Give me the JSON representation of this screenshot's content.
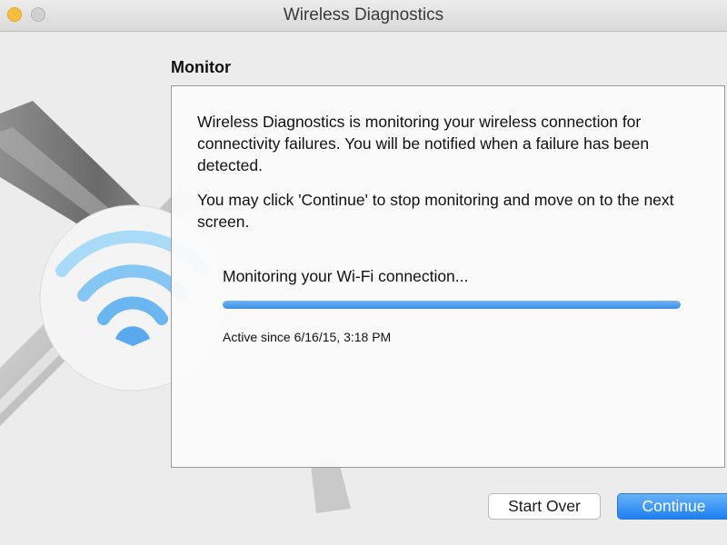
{
  "window": {
    "title": "Wireless Diagnostics"
  },
  "section": {
    "title": "Monitor"
  },
  "panel": {
    "paragraph1": "Wireless Diagnostics is monitoring your wireless connection for connectivity failures. You will be notified when a failure has been detected.",
    "paragraph2": "You may click 'Continue' to stop monitoring and move on to the next screen.",
    "status_text": "Monitoring your Wi-Fi connection...",
    "progress": 1.0,
    "active_since": "Active since 6/16/15, 3:18 PM"
  },
  "buttons": {
    "start_over": "Start Over",
    "continue": "Continue"
  },
  "icons": {
    "close": "close-icon",
    "minimize": "minimize-icon",
    "zoom": "zoom-icon",
    "app": "wifi-icon",
    "tools": "tools-icon"
  },
  "colors": {
    "accent": "#1e7ff2",
    "progress": "#3d8ee8",
    "wifi": "#5ab4f0",
    "minimize": "#f6be3f"
  }
}
